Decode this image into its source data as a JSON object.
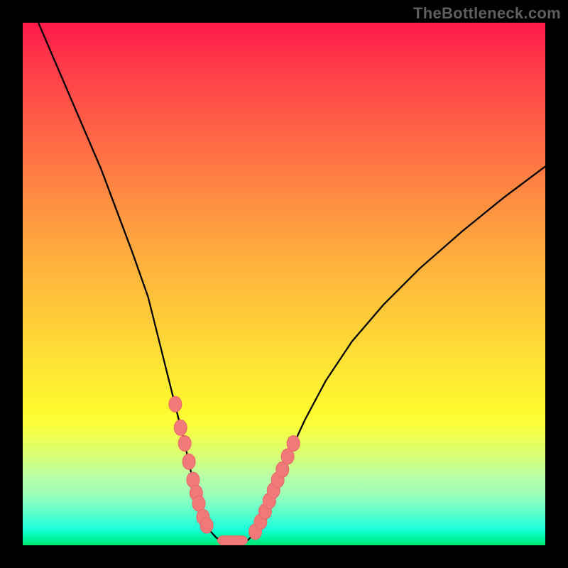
{
  "source_label": "TheBottleneck.com",
  "colors": {
    "curve": "#000000",
    "marker_fill": "#f1797a",
    "marker_stroke": "#e86666",
    "band_left_border": "#000000",
    "band_right_border": "#000000"
  },
  "chart_data": {
    "type": "line",
    "title": "",
    "xlabel": "",
    "ylabel": "",
    "xlim": [
      0,
      100
    ],
    "ylim": [
      0,
      100
    ],
    "x": [
      3,
      6,
      9,
      12,
      15,
      18,
      21,
      24,
      26,
      28,
      29.5,
      31,
      32.2,
      33.2,
      33.9,
      34.5,
      35,
      36,
      37,
      38,
      39,
      40,
      41,
      42,
      43,
      44,
      45,
      46,
      47.5,
      49,
      51,
      54,
      58,
      63,
      69,
      76,
      84,
      92,
      100
    ],
    "values": [
      100,
      93,
      86,
      79,
      72,
      64,
      56,
      47.5,
      39.5,
      31.5,
      25.5,
      19.5,
      14,
      10,
      7.3,
      5.4,
      4.2,
      2.6,
      1.5,
      0.8,
      0.3,
      0.1,
      0.1,
      0.3,
      0.9,
      1.9,
      3.5,
      5.8,
      9,
      12.7,
      17.5,
      24,
      31.5,
      39,
      46,
      53,
      60,
      66.5,
      72.5
    ],
    "markers": {
      "x": [
        29.2,
        30.2,
        31,
        31.8,
        32.6,
        33.2,
        33.7,
        34.5,
        35.2,
        44.5,
        45.5,
        46.4,
        47.2,
        48,
        48.8,
        49.7,
        50.7,
        51.8
      ],
      "values": [
        27,
        22.5,
        19.5,
        16,
        12.5,
        10,
        8,
        5.4,
        3.8,
        2.6,
        4.5,
        6.5,
        8.5,
        10.5,
        12.5,
        14.5,
        17,
        19.5
      ]
    },
    "flat_band": {
      "x_start": 37.3,
      "x_end": 43
    },
    "grid": false,
    "legend": false
  }
}
